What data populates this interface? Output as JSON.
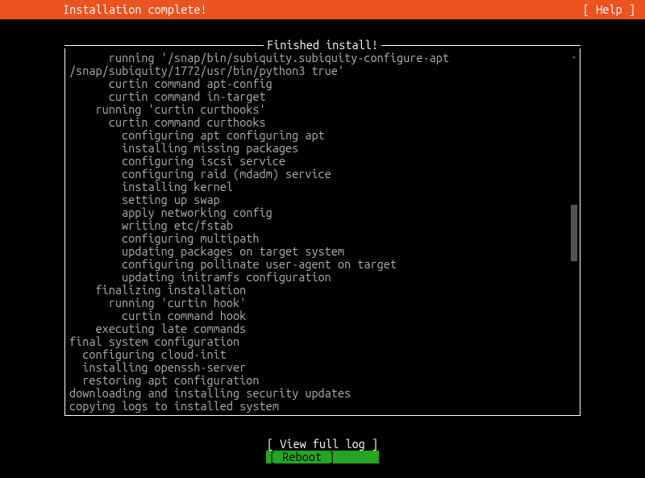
{
  "header": {
    "title": "Installation complete!",
    "help_label": "[ Help ]"
  },
  "panel": {
    "title": " Finished install! "
  },
  "log": {
    "lines": [
      "      running '/snap/bin/subiquity.subiquity-configure-apt",
      "/snap/subiquity/1772/usr/bin/python3 true'",
      "      curtin command apt-config",
      "      curtin command in-target",
      "    running 'curtin curthooks'",
      "      curtin command curthooks",
      "        configuring apt configuring apt",
      "        installing missing packages",
      "        configuring iscsi service",
      "        configuring raid (mdadm) service",
      "        installing kernel",
      "        setting up swap",
      "        apply networking config",
      "        writing etc/fstab",
      "        configuring multipath",
      "        updating packages on target system",
      "        configuring pollinate user-agent on target",
      "        updating initramfs configuration",
      "    finalizing installation",
      "      running 'curtin hook'",
      "        curtin command hook",
      "    executing late commands",
      "final system configuration",
      "  configuring cloud-init",
      "  installing openssh-server",
      "  restoring apt configuration",
      "downloading and installing security updates",
      "copying logs to installed system"
    ]
  },
  "buttons": {
    "view_log": "[ View full log ]",
    "reboot": "[ Reboot         ]"
  }
}
